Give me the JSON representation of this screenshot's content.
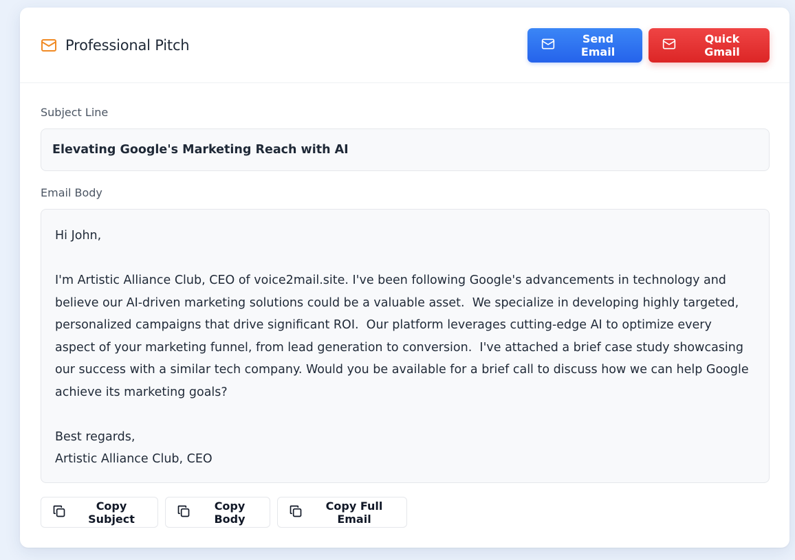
{
  "header": {
    "title": "Professional Pitch",
    "title_icon": "mail-icon",
    "accent_color": "#f08a24",
    "send_label": "Send Email",
    "gmail_label": "Quick Gmail",
    "send_color": "#2f74f0",
    "gmail_color": "#e53935"
  },
  "subject": {
    "label": "Subject Line",
    "value": "Elevating Google's Marketing Reach with AI"
  },
  "body": {
    "label": "Email Body",
    "value": "Hi John,\n\nI'm Artistic Alliance Club, CEO of voice2mail.site. I've been following Google's advancements in technology and believe our AI-driven marketing solutions could be a valuable asset.  We specialize in developing highly targeted, personalized campaigns that drive significant ROI.  Our platform leverages cutting-edge AI to optimize every aspect of your marketing funnel, from lead generation to conversion.  I've attached a brief case study showcasing our success with a similar tech company. Would you be available for a brief call to discuss how we can help Google achieve its marketing goals?\n\nBest regards,\nArtistic Alliance Club, CEO"
  },
  "copy_actions": {
    "subject_label": "Copy Subject",
    "body_label": "Copy Body",
    "full_label": "Copy Full Email",
    "icon": "copy-icon"
  }
}
